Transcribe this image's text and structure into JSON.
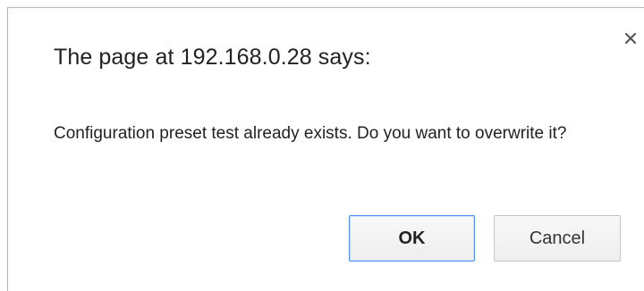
{
  "dialog": {
    "title": "The page at 192.168.0.28 says:",
    "message": "Configuration preset test already exists. Do you want to overwrite it?",
    "close_icon": "close-icon",
    "buttons": {
      "ok_label": "OK",
      "cancel_label": "Cancel"
    }
  },
  "colors": {
    "ok_border": "#4d90fe",
    "cancel_border": "#c6c6c6",
    "text": "#222222",
    "background": "#ffffff"
  }
}
